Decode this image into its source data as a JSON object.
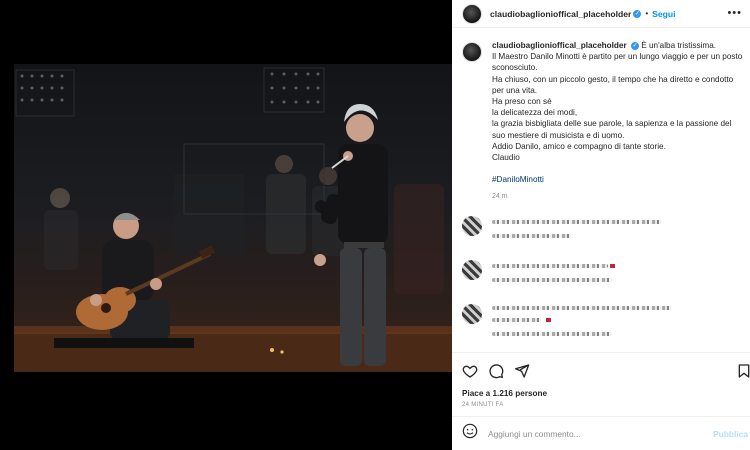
{
  "post": {
    "username": "claudiobaglionioffical_placeholder",
    "follow_label": "Segui",
    "more_label": "•••"
  },
  "caption": {
    "username": "claudiobaglionioffical_placeholder",
    "lines": [
      "È un'alba tristissima.",
      "Il Maestro Danilo Minotti è partito per un lungo viaggio e per un posto sconosciuto.",
      "Ha chiuso, con un piccolo gesto, il tempo che ha diretto e condotto per una vita.",
      "Ha preso con sé",
      "la delicatezza dei modi,",
      "la grazia bisbigliata delle sue parole, la sapienza e la passione del suo mestiere di musicista e di uomo.",
      "Addio Danilo, amico e compagno di tante storie.",
      "Claudio"
    ],
    "hashtag": "#DaniloMinotti",
    "time": "24 m"
  },
  "engagement": {
    "likes": "Piace a 1.216 persone",
    "ago": "24 MINUTI FA"
  },
  "comment_box": {
    "placeholder": "Aggiungi un commento...",
    "publish": "Pubblica"
  },
  "icons": [
    "heart-icon",
    "comment-icon",
    "share-icon",
    "bookmark-icon",
    "smiley-icon",
    "verified-icon",
    "more-icon"
  ],
  "colors": {
    "accent": "#0095f6",
    "verified": "#3897f0",
    "publish_disabled": "#b2dffc"
  }
}
